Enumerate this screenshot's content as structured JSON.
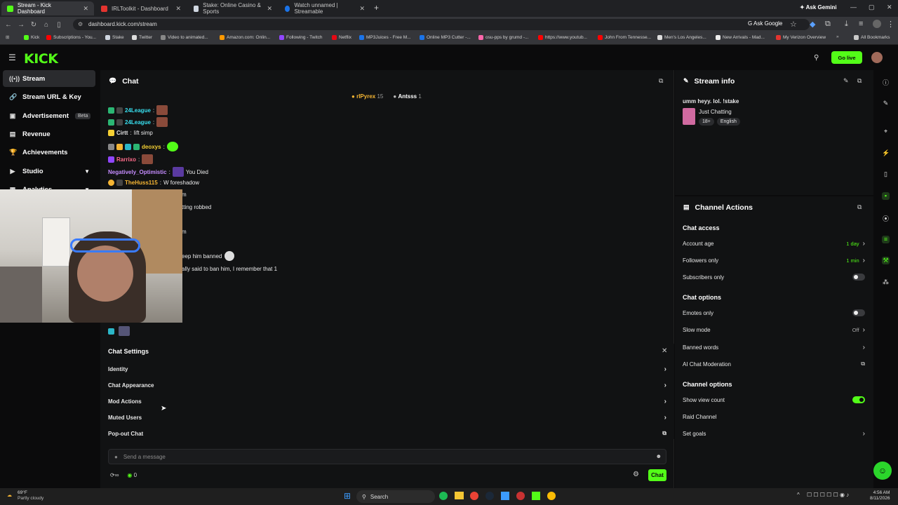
{
  "browser": {
    "tabs": [
      {
        "label": "Stream - Kick Dashboard",
        "color": "#53fc18"
      },
      {
        "label": "IRLToolkit - Dashboard",
        "color": "#e3342f"
      },
      {
        "label": "Stake: Online Casino & Sports",
        "color": "#cfd6e0"
      },
      {
        "label": "Watch unnamed | Streamable",
        "color": "#1a73e8"
      }
    ],
    "ask_gemini": "Ask Gemini",
    "url": "dashboard.kick.com/stream",
    "ask_google": "Ask Google",
    "bookmarks": [
      "Kick",
      "Subscriptions - You...",
      "Stake",
      "Twitter",
      "Video to animated...",
      "Amazon.com: Onlin...",
      "Following - Twitch",
      "Netflix",
      "MP3Juices - Free M...",
      "Online MP3 Cutter -...",
      "osu-pps by grumd -...",
      "https://www.youtub...",
      "John From Tennesse...",
      "Men's Los Angeles...",
      "New Arrivals - Mad...",
      "My Verizon Overview",
      "All Bookmarks"
    ]
  },
  "header": {
    "logo": "KICK",
    "go_live": "Go live"
  },
  "sidebar": {
    "items": [
      {
        "label": "Stream",
        "icon": "stream-icon"
      },
      {
        "label": "Stream URL & Key",
        "icon": "link-icon"
      },
      {
        "label": "Advertisement",
        "icon": "ad-icon",
        "badge": "Beta"
      },
      {
        "label": "Revenue",
        "icon": "chart-icon"
      },
      {
        "label": "Achievements",
        "icon": "trophy-icon"
      },
      {
        "label": "Studio",
        "icon": "video-icon"
      },
      {
        "label": "Analytics",
        "icon": "analytics-icon"
      }
    ]
  },
  "chat": {
    "title": "Chat",
    "top_users": [
      {
        "name": "rIPyrex",
        "count": "15"
      },
      {
        "name": "Antsss",
        "count": "1"
      }
    ],
    "messages": [
      {
        "user": "24League",
        "text": "",
        "color": "#38e0f0"
      },
      {
        "user": "24League",
        "text": "",
        "color": "#38e0f0"
      },
      {
        "user": "Cirtt",
        "text": "lift simp",
        "color": "#e6e6e6"
      },
      {
        "user": "deoxys",
        "text": "",
        "color": "#f5d033"
      },
      {
        "user": "Rarrixo",
        "text": "",
        "color": "#ff6b8a"
      },
      {
        "user": "Negatively_Optimistic",
        "text": "You Died",
        "color": "#c58cff"
      },
      {
        "user": "TheHuss115",
        "text": "W foreshadow",
        "color": "#f5b533"
      }
    ],
    "partial_lines": [
      "m",
      "tting robbed",
      "m",
      "eep him banned",
      "ally said to ban him, I remember that 1"
    ],
    "settings_title": "Chat Settings",
    "settings_items": [
      "Identity",
      "Chat Appearance",
      "Mod Actions",
      "Muted Users",
      "Pop-out Chat"
    ],
    "input_placeholder": "Send a message",
    "footer_count": "0",
    "send_label": "Chat"
  },
  "stream_info": {
    "title": "Stream info",
    "stream_title": "umm heyy. lol. !stake",
    "category": "Just Chatting",
    "tags": [
      "18+",
      "English"
    ]
  },
  "channel_actions": {
    "title": "Channel Actions",
    "chat_access_heading": "Chat access",
    "account_age_label": "Account age",
    "account_age_value": "1 day",
    "followers_only_label": "Followers only",
    "followers_only_value": "1 min",
    "subscribers_only_label": "Subscribers only",
    "chat_options_heading": "Chat options",
    "emotes_only_label": "Emotes only",
    "slow_mode_label": "Slow mode",
    "slow_mode_value": "Off",
    "banned_words_label": "Banned words",
    "ai_moderation_label": "AI Chat Moderation",
    "channel_options_heading": "Channel options",
    "show_view_count_label": "Show view count",
    "show_view_count_enabled": true,
    "raid_channel_label": "Raid Channel",
    "set_goals_label": "Set goals"
  },
  "taskbar": {
    "weather_temp": "69°F",
    "weather_desc": "Partly cloudy",
    "search": "Search",
    "time": "4:56 AM",
    "date": "8/11/2026"
  },
  "accent_color": "#53fc18"
}
